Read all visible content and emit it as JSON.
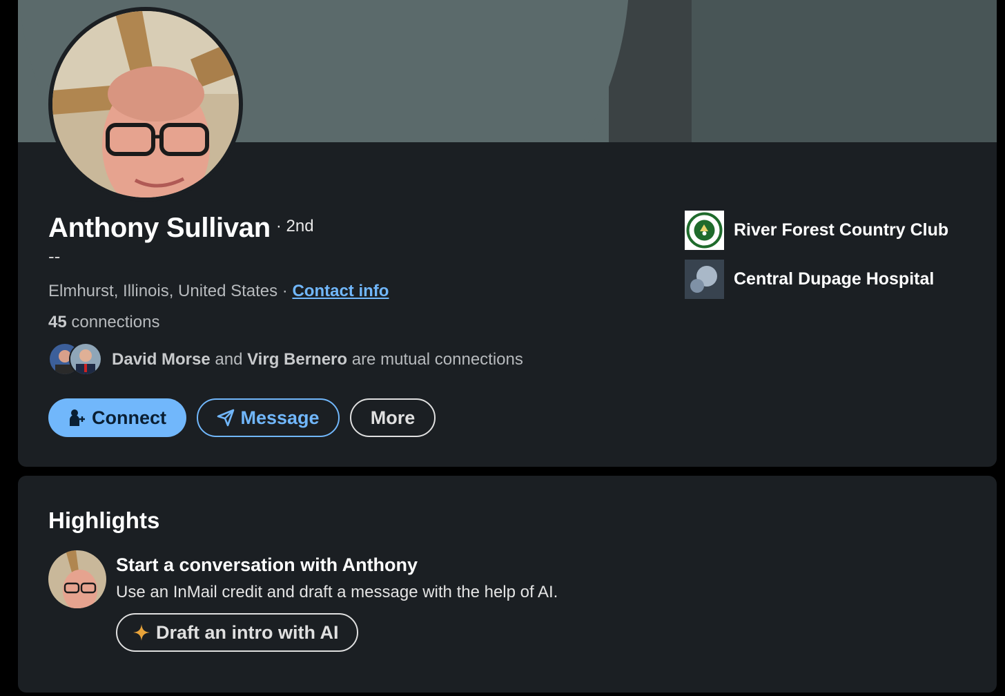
{
  "profile": {
    "name": "Anthony Sullivan",
    "degree": "· 2nd",
    "headline": "--",
    "location": "Elmhurst, Illinois, United States",
    "location_separator": " · ",
    "contact_info_label": "Contact info",
    "connections_count": "45",
    "connections_label": " connections",
    "mutual": {
      "first": "David Morse",
      "and": " and ",
      "second": "Virg Bernero",
      "suffix": " are mutual connections"
    },
    "actions": {
      "connect_label": "Connect",
      "message_label": "Message",
      "more_label": "More"
    },
    "organizations": [
      {
        "name": "River Forest Country Club",
        "icon": "club-logo-icon"
      },
      {
        "name": "Central Dupage Hospital",
        "icon": "placeholder-company-icon"
      }
    ]
  },
  "highlights": {
    "title": "Highlights",
    "heading": "Start a conversation with Anthony",
    "subtext": "Use an InMail credit and draft a message with the help of AI.",
    "ai_button_label": "Draft an intro with AI"
  },
  "colors": {
    "accent": "#71b7fb",
    "card_bg": "#1b1f23",
    "page_bg": "#000000",
    "banner": "#5b6a6b",
    "ai_star": "#e8a33a"
  }
}
